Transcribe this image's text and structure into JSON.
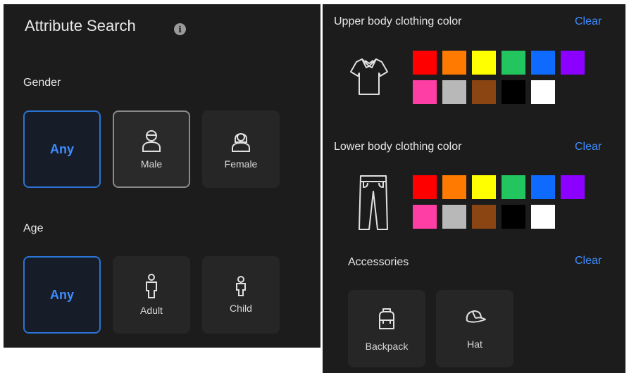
{
  "left": {
    "title": "Attribute Search",
    "info_icon": "info-icon",
    "gender": {
      "label": "Gender",
      "options": [
        "Any",
        "Male",
        "Female"
      ]
    },
    "age": {
      "label": "Age",
      "options": [
        "Any",
        "Adult",
        "Child"
      ]
    }
  },
  "right": {
    "upper": {
      "label": "Upper body clothing color",
      "clear": "Clear",
      "icon": "shirt-icon"
    },
    "lower": {
      "label": "Lower body clothing color",
      "clear": "Clear",
      "icon": "pants-icon"
    },
    "accessories": {
      "label": "Accessories",
      "clear": "Clear",
      "items": [
        "Backpack",
        "Hat"
      ]
    },
    "colors": [
      "#ff0000",
      "#ff7a00",
      "#ffff00",
      "#22c55e",
      "#0f6bff",
      "#8b00ff",
      "#ff3ea5",
      "#b8b8b8",
      "#8b4513",
      "#000000",
      "#ffffff"
    ]
  }
}
